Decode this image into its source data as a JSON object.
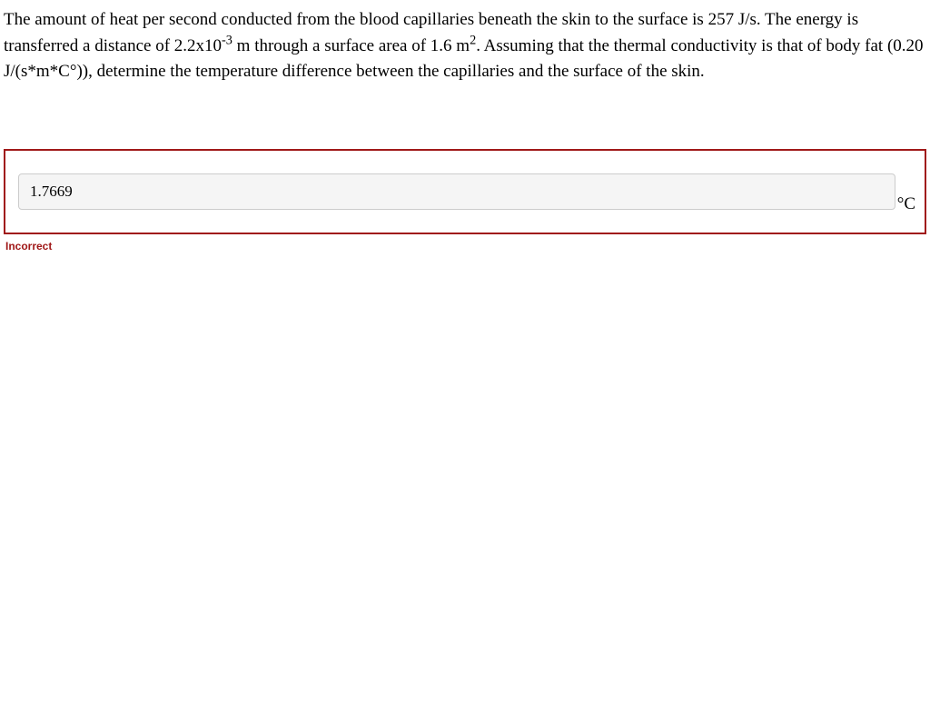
{
  "question": {
    "part1": "The amount of heat per second conducted from the blood capillaries beneath the skin to the surface is 257 J/s. The energy is transferred a distance of 2.2x10",
    "exp1": "-3",
    "part2": " m through a surface area of 1.6 m",
    "exp2": "2",
    "part3": ". Assuming that the thermal conductivity is that of body fat (0.20 J/(s*m*C°)), determine the temperature difference between the capillaries and the surface of the skin."
  },
  "answer": {
    "value": "1.7669",
    "unit": "°C"
  },
  "feedback": {
    "status": "Incorrect"
  }
}
